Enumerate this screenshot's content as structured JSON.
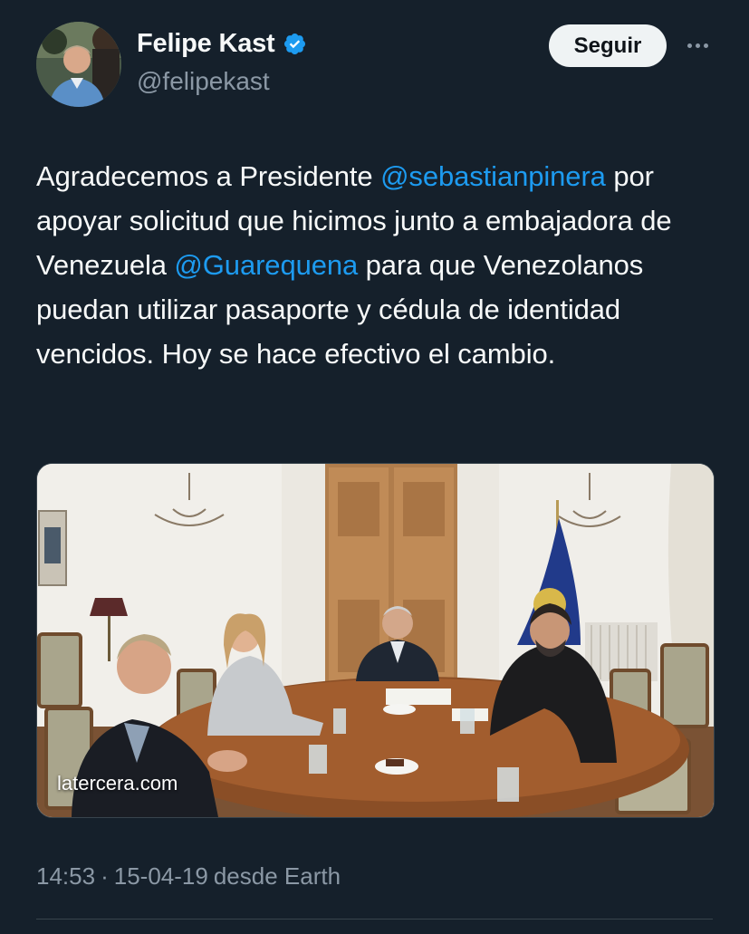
{
  "user": {
    "display_name": "Felipe Kast",
    "handle": "@felipekast",
    "verified": true,
    "verified_icon": "verified-badge-icon",
    "verified_color": "#1d9bf0"
  },
  "actions": {
    "follow_label": "Seguir",
    "more_icon": "more-options-icon"
  },
  "tweet": {
    "text_1": "Agradecemos a Presidente ",
    "mention_1": "@sebastianpinera",
    "text_2": " por apoyar solicitud que hicimos junto a embajadora de Venezuela ",
    "mention_2": "@Guarequena",
    "text_3": " para que Venezolanos puedan utilizar pasaporte y cédula de identidad vencidos. Hoy se hace efectivo el cambio."
  },
  "media": {
    "source_label": "latercera.com"
  },
  "meta": {
    "time": "14:53",
    "separator": "·",
    "date": "15-04-19",
    "source": "desde Earth"
  },
  "colors": {
    "background": "#15202b",
    "mention": "#1d9bf0",
    "secondary_text": "#8b98a5"
  }
}
